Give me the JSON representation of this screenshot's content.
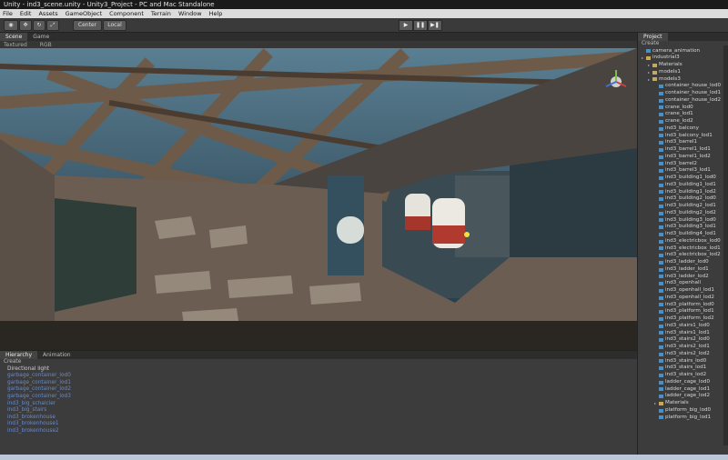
{
  "window": {
    "title": "Unity - ind3_scene.unity - Unity3_Project - PC and Mac Standalone"
  },
  "menu": [
    "File",
    "Edit",
    "Assets",
    "GameObject",
    "Component",
    "Terrain",
    "Window",
    "Help"
  ],
  "toolbar": {
    "center_label": "Center",
    "local_label": "Local"
  },
  "scene_panel": {
    "tabs": [
      "Scene",
      "Game"
    ],
    "draw_mode": "Textured",
    "render_mode": "RGB"
  },
  "hierarchy": {
    "tabs": [
      "Hierarchy",
      "Animation"
    ],
    "create_label": "Create",
    "items": [
      "Directional light",
      "garbage_container_lod0",
      "garbage_container_lod1",
      "garbage_container_lod2",
      "garbage_container_lod3",
      "ind3_big_schalcier",
      "ind3_big_stairs",
      "ind3_brokenhouse",
      "ind3_brokenhouse1",
      "ind3_brokenhouse2"
    ]
  },
  "project": {
    "tab_label": "Project",
    "create_label": "Create",
    "items": [
      {
        "label": "camera_animation",
        "kind": "file",
        "depth": 0
      },
      {
        "label": "industrial3",
        "kind": "folder",
        "depth": 0
      },
      {
        "label": "Materials",
        "kind": "folder",
        "depth": 1
      },
      {
        "label": "models1",
        "kind": "folder",
        "depth": 1
      },
      {
        "label": "models3",
        "kind": "folder",
        "depth": 1
      },
      {
        "label": "container_house_lod0",
        "kind": "file",
        "depth": 2
      },
      {
        "label": "container_house_lod1",
        "kind": "file",
        "depth": 2
      },
      {
        "label": "container_house_lod2",
        "kind": "file",
        "depth": 2
      },
      {
        "label": "crane_lod0",
        "kind": "file",
        "depth": 2
      },
      {
        "label": "crane_lod1",
        "kind": "file",
        "depth": 2
      },
      {
        "label": "crane_lod2",
        "kind": "file",
        "depth": 2
      },
      {
        "label": "ind3_balcony",
        "kind": "file",
        "depth": 2
      },
      {
        "label": "ind3_balcony_lod1",
        "kind": "file",
        "depth": 2
      },
      {
        "label": "ind3_barrel1",
        "kind": "file",
        "depth": 2
      },
      {
        "label": "ind3_barrel1_lod1",
        "kind": "file",
        "depth": 2
      },
      {
        "label": "ind3_barrel1_lod2",
        "kind": "file",
        "depth": 2
      },
      {
        "label": "ind3_barrel2",
        "kind": "file",
        "depth": 2
      },
      {
        "label": "ind3_barrel3_lod1",
        "kind": "file",
        "depth": 2
      },
      {
        "label": "ind3_building1_lod0",
        "kind": "file",
        "depth": 2
      },
      {
        "label": "ind3_building1_lod1",
        "kind": "file",
        "depth": 2
      },
      {
        "label": "ind3_building1_lod2",
        "kind": "file",
        "depth": 2
      },
      {
        "label": "ind3_building2_lod0",
        "kind": "file",
        "depth": 2
      },
      {
        "label": "ind3_building2_lod1",
        "kind": "file",
        "depth": 2
      },
      {
        "label": "ind3_building2_lod2",
        "kind": "file",
        "depth": 2
      },
      {
        "label": "ind3_building3_lod0",
        "kind": "file",
        "depth": 2
      },
      {
        "label": "ind3_building3_lod1",
        "kind": "file",
        "depth": 2
      },
      {
        "label": "ind3_building4_lod1",
        "kind": "file",
        "depth": 2
      },
      {
        "label": "ind3_electricbox_lod0",
        "kind": "file",
        "depth": 2
      },
      {
        "label": "ind3_electricbox_lod1",
        "kind": "file",
        "depth": 2
      },
      {
        "label": "ind3_electricbox_lod2",
        "kind": "file",
        "depth": 2
      },
      {
        "label": "ind3_ladder_lod0",
        "kind": "file",
        "depth": 2
      },
      {
        "label": "ind3_ladder_lod1",
        "kind": "file",
        "depth": 2
      },
      {
        "label": "ind3_ladder_lod2",
        "kind": "file",
        "depth": 2
      },
      {
        "label": "ind3_openhall",
        "kind": "file",
        "depth": 2
      },
      {
        "label": "ind3_openhall_lod1",
        "kind": "file",
        "depth": 2
      },
      {
        "label": "ind3_openhall_lod2",
        "kind": "file",
        "depth": 2
      },
      {
        "label": "ind3_platform_lod0",
        "kind": "file",
        "depth": 2
      },
      {
        "label": "ind3_platform_lod1",
        "kind": "file",
        "depth": 2
      },
      {
        "label": "ind3_platform_lod2",
        "kind": "file",
        "depth": 2
      },
      {
        "label": "ind3_stairs1_lod0",
        "kind": "file",
        "depth": 2
      },
      {
        "label": "ind3_stairs1_lod1",
        "kind": "file",
        "depth": 2
      },
      {
        "label": "ind3_stairs2_lod0",
        "kind": "file",
        "depth": 2
      },
      {
        "label": "ind3_stairs2_lod1",
        "kind": "file",
        "depth": 2
      },
      {
        "label": "ind3_stairs2_lod2",
        "kind": "file",
        "depth": 2
      },
      {
        "label": "ind3_stairs_lod0",
        "kind": "file",
        "depth": 2
      },
      {
        "label": "ind3_stairs_lod1",
        "kind": "file",
        "depth": 2
      },
      {
        "label": "ind3_stairs_lod2",
        "kind": "file",
        "depth": 2
      },
      {
        "label": "ladder_cage_lod0",
        "kind": "file",
        "depth": 2
      },
      {
        "label": "ladder_cage_lod1",
        "kind": "file",
        "depth": 2
      },
      {
        "label": "ladder_cage_lod2",
        "kind": "file",
        "depth": 2
      },
      {
        "label": "Materials",
        "kind": "folder",
        "depth": 2
      },
      {
        "label": "platform_big_lod0",
        "kind": "file",
        "depth": 2
      },
      {
        "label": "platform_big_lod1",
        "kind": "file",
        "depth": 2
      }
    ]
  },
  "colors": {
    "panel_bg": "#3c3c3c",
    "hierarchy_link": "#6a8ac8",
    "menu_bg": "#dcdcdc"
  }
}
